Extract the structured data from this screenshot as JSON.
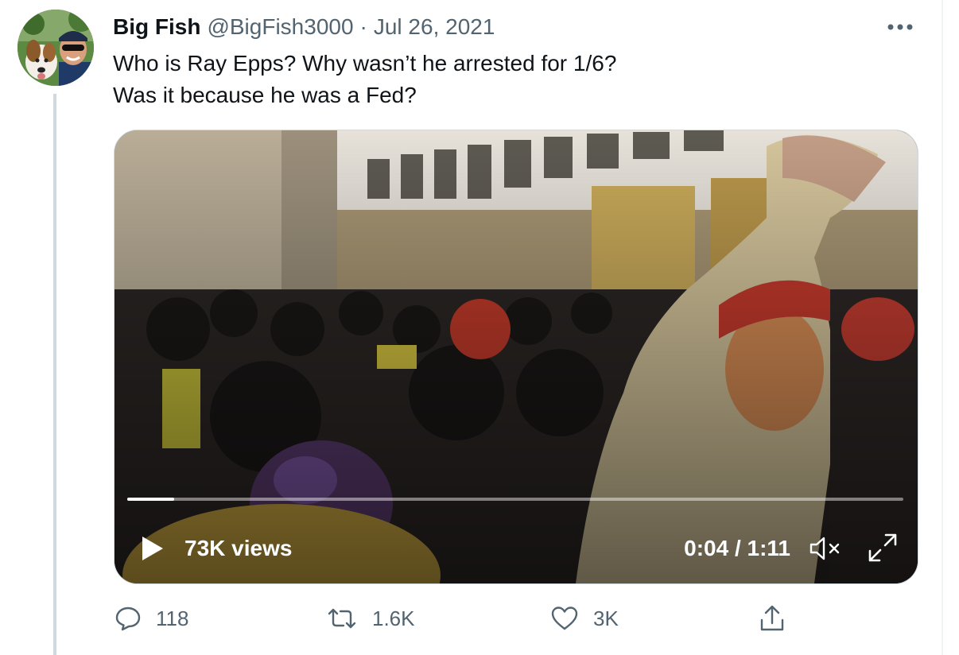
{
  "tweet": {
    "author_name": "Big Fish",
    "handle": "@BigFish3000",
    "separator": "·",
    "date": "Jul 26, 2021",
    "text_lines": [
      "Who is Ray Epps? Why wasn’t he arrested for 1/6?",
      "Was it because he was a Fed?"
    ]
  },
  "video": {
    "views": "73K views",
    "timecode": "0:04 / 1:11",
    "progress_fraction": 0.06
  },
  "actions": {
    "replies": "118",
    "retweets": "1.6K",
    "likes": "3K"
  },
  "icons": {
    "more": "more-horizontal-icon",
    "reply": "reply-icon",
    "retweet": "retweet-icon",
    "like": "heart-icon",
    "share": "share-icon",
    "play": "play-icon",
    "mute": "muted-speaker-icon",
    "fullscreen": "fullscreen-icon"
  },
  "colors": {
    "text_primary": "#0f1419",
    "text_secondary": "#536471",
    "border": "#cfd9de"
  }
}
